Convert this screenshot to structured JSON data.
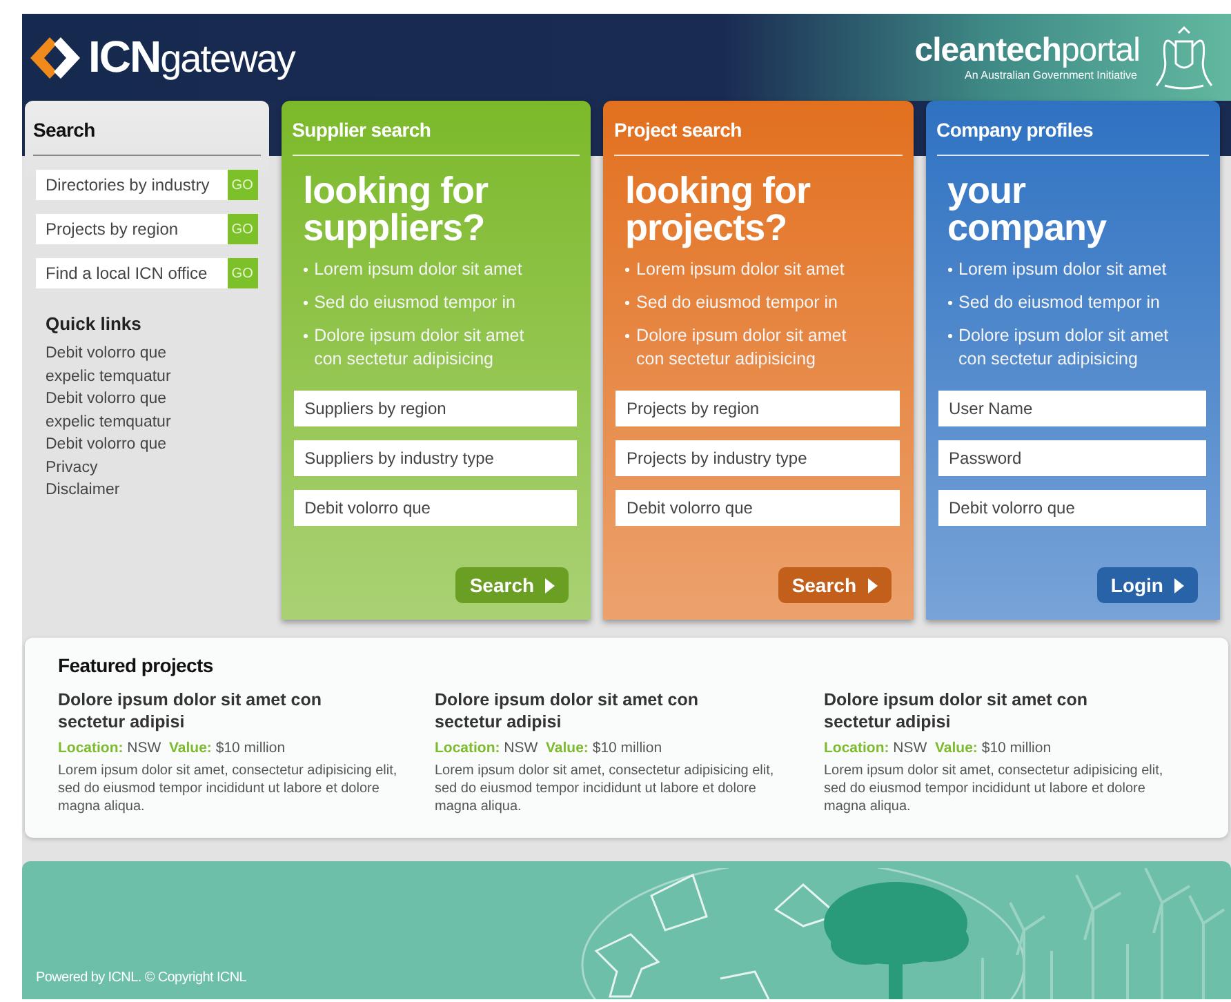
{
  "header": {
    "logo": {
      "bold": "ICN",
      "light": "gateway"
    },
    "partner": {
      "bold": "cleantech",
      "light": "portal",
      "tagline": "An Australian Government Initiative"
    }
  },
  "sidebar": {
    "title": "Search",
    "quick_searches": [
      {
        "label": "Directories by industry",
        "button": "GO"
      },
      {
        "label": "Projects by region",
        "button": "GO"
      },
      {
        "label": "Find a local ICN office",
        "button": "GO"
      }
    ],
    "quick_links_title": "Quick links",
    "quick_links": [
      "Debit volorro que",
      "expelic temquatur",
      "Debit volorro que",
      "expelic temquatur",
      "Debit volorro que",
      "Privacy",
      "Disclaimer"
    ]
  },
  "panels": [
    {
      "title": "Supplier search",
      "color": "#7cb92a",
      "headline": "looking for suppliers?",
      "bullets": [
        "Lorem ipsum dolor sit amet",
        "Sed do eiusmod tempor in",
        "Dolore ipsum dolor sit amet con sectetur adipisicing"
      ],
      "fields": [
        "Suppliers by region",
        "Suppliers by industry type",
        "Debit volorro que"
      ],
      "button": "Search"
    },
    {
      "title": "Project search",
      "color": "#e2701f",
      "headline": "looking for projects?",
      "bullets": [
        "Lorem ipsum dolor sit amet",
        "Sed do eiusmod tempor in",
        "Dolore ipsum dolor sit amet con sectetur adipisicing"
      ],
      "fields": [
        "Projects by region",
        "Projects by industry type",
        "Debit volorro que"
      ],
      "button": "Search"
    },
    {
      "title": "Company profiles",
      "color": "#2f72c2",
      "headline": "your company",
      "bullets": [
        "Lorem ipsum dolor sit amet",
        "Sed do eiusmod tempor in",
        "Dolore ipsum dolor sit amet con sectetur adipisicing"
      ],
      "fields": [
        "User Name",
        "Password",
        "Debit volorro que"
      ],
      "button": "Login"
    }
  ],
  "featured": {
    "title": "Featured projects",
    "items": [
      {
        "title": "Dolore ipsum dolor sit amet con sectetur adipisi",
        "meta": "**Location:** NSW  **Value:** $10 million",
        "text": "Lorem ipsum dolor sit amet, consectetur adipisicing elit, sed do eiusmod tempor incididunt ut labore et dolore magna aliqua."
      },
      {
        "title": "Dolore ipsum dolor sit amet con sectetur adipisi",
        "meta": "**Location:** NSW  **Value:** $10 million",
        "text": "Lorem ipsum dolor sit amet, consectetur adipisicing elit, sed do eiusmod tempor incididunt ut labore et dolore magna aliqua."
      },
      {
        "title": "Dolore ipsum dolor sit amet con sectetur adipisi",
        "meta": "**Location:** NSW  **Value:** $10 million",
        "text": "Lorem ipsum dolor sit amet, consectetur adipisicing elit, sed do eiusmod tempor incididunt ut labore et dolore magna aliqua."
      }
    ]
  },
  "footer": {
    "text": "Powered by ICNL. © Copyright ICNL"
  }
}
